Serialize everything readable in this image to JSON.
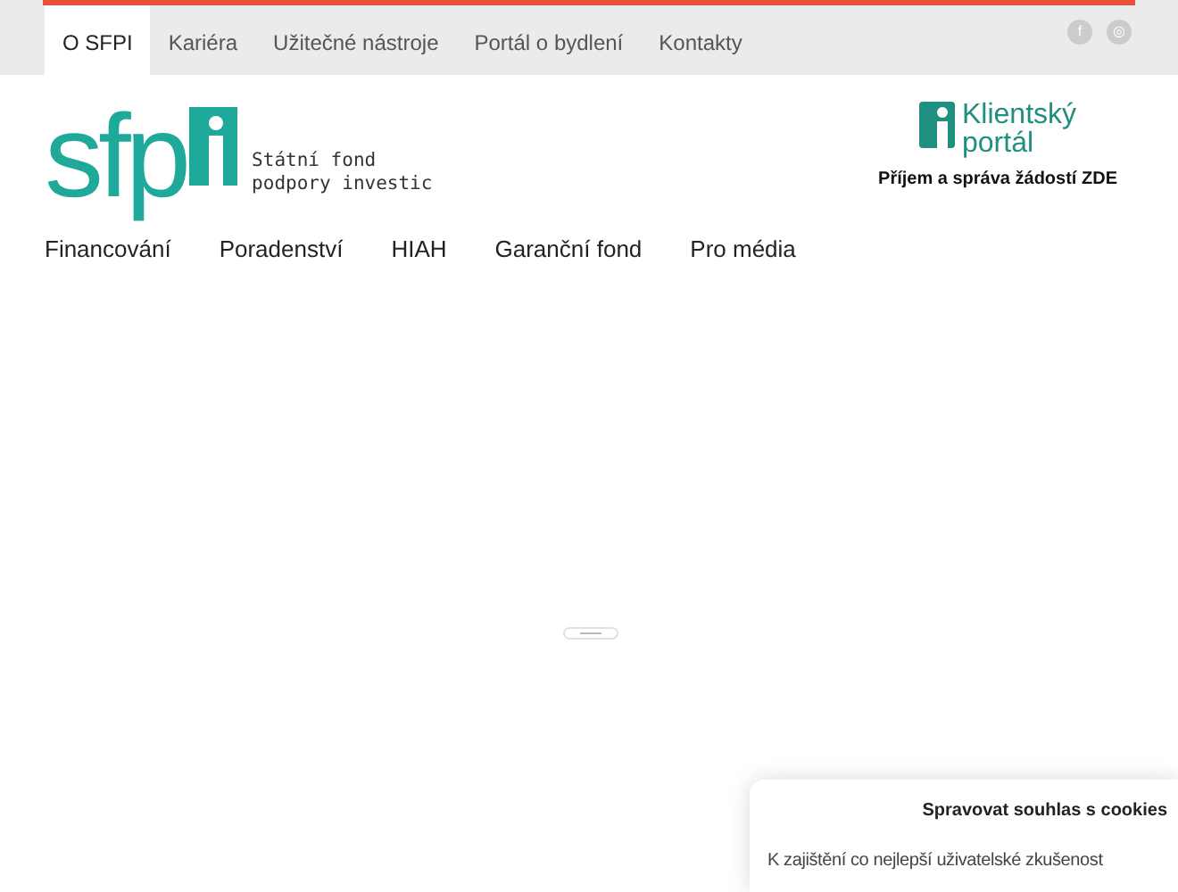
{
  "top_nav": [
    {
      "label": "O SFPI",
      "selected": true
    },
    {
      "label": "Kariéra",
      "selected": false
    },
    {
      "label": "Užitečné nástroje",
      "selected": false
    },
    {
      "label": "Portál o bydlení",
      "selected": false
    },
    {
      "label": "Kontakty",
      "selected": false
    }
  ],
  "social": [
    "f",
    "◎"
  ],
  "logo": {
    "letters": "sfp",
    "line_1": "Státní fond",
    "line_2": "podpory investic"
  },
  "portal": {
    "line_1": "Klientský",
    "line_2": "portál",
    "caption": "Příjem a správa žádostí ZDE"
  },
  "main_nav": [
    "Financování",
    "Poradenství",
    "HIAH",
    "Garanční fond",
    "Pro média"
  ],
  "cookie_panel": {
    "title": "Spravovat souhlas s cookies",
    "text": "K zajištění co nejlepší uživatelské zkušenost"
  }
}
